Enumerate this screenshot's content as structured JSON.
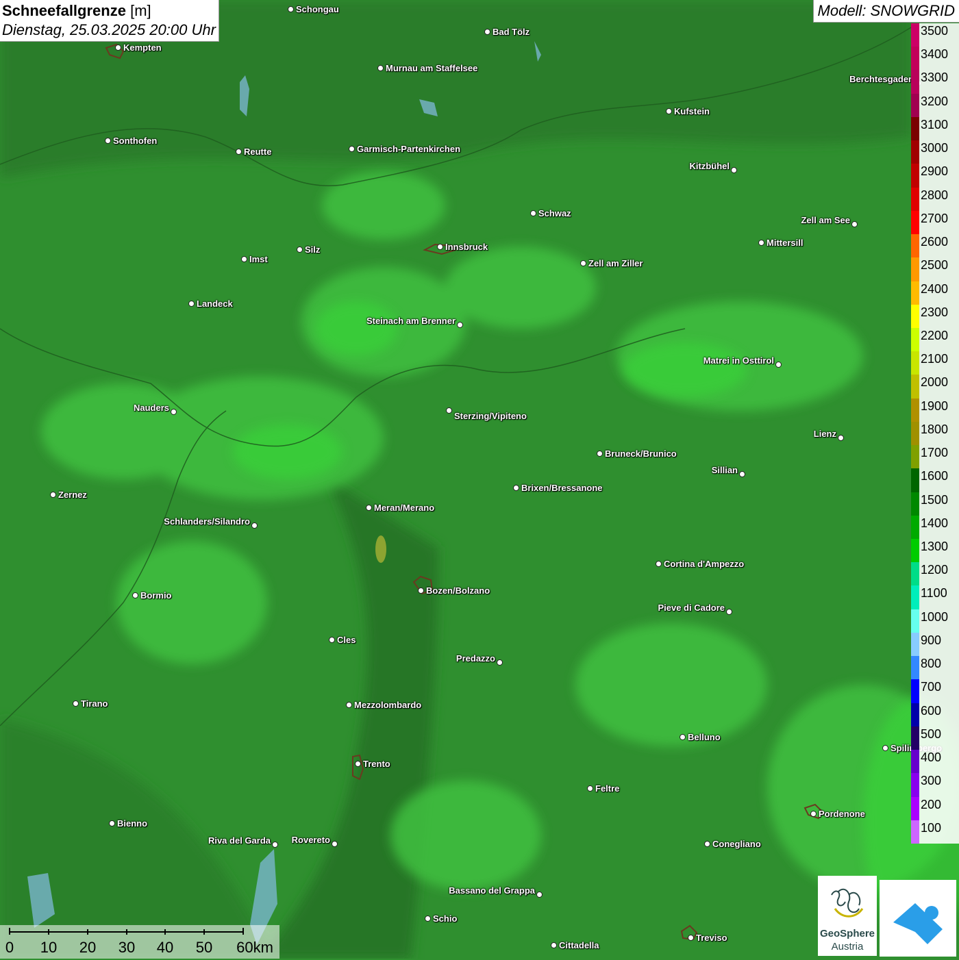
{
  "title": {
    "main": "Schneefallgrenze",
    "unit": "[m]",
    "datetime": "Dienstag, 25.03.2025 20:00 Uhr"
  },
  "model": "Modell: SNOWGRID",
  "legend": {
    "labels": [
      "3500",
      "3400",
      "3300",
      "3200",
      "3100",
      "3000",
      "2900",
      "2800",
      "2700",
      "2600",
      "2500",
      "2400",
      "2300",
      "2200",
      "2100",
      "2000",
      "1900",
      "1800",
      "1700",
      "1600",
      "1500",
      "1400",
      "1300",
      "1200",
      "1100",
      "1000",
      "900",
      "800",
      "700",
      "600",
      "500",
      "400",
      "300",
      "200",
      "100"
    ],
    "colors": [
      "#cc0066",
      "#c2005a",
      "#b8005a",
      "#a00050",
      "#7a0000",
      "#a00000",
      "#c00000",
      "#e00000",
      "#ff0000",
      "#ff6600",
      "#ff9900",
      "#ffbb00",
      "#ffff00",
      "#ccff00",
      "#c8e600",
      "#c0c000",
      "#b09000",
      "#a09000",
      "#80a000",
      "#006600",
      "#008800",
      "#00aa00",
      "#00cc00",
      "#00dd88",
      "#00eebb",
      "#66ffee",
      "#88ccff",
      "#3388ff",
      "#0000ff",
      "#0000aa",
      "#220066",
      "#6600cc",
      "#8800ee",
      "#aa00ff",
      "#cc66ff"
    ]
  },
  "cities": [
    {
      "name": "Schongau"
    },
    {
      "name": "Bad Tölz"
    },
    {
      "name": "Kempten"
    },
    {
      "name": "Murnau am Staffelsee"
    },
    {
      "name": "Berchtesgaden"
    },
    {
      "name": "Kufstein"
    },
    {
      "name": "Sonthofen"
    },
    {
      "name": "Reutte"
    },
    {
      "name": "Garmisch-Partenkirchen"
    },
    {
      "name": "Kitzbühel"
    },
    {
      "name": "Schwaz"
    },
    {
      "name": "Zell am See"
    },
    {
      "name": "Innsbruck"
    },
    {
      "name": "Mittersill"
    },
    {
      "name": "Imst"
    },
    {
      "name": "Silz"
    },
    {
      "name": "Zell am Ziller"
    },
    {
      "name": "Landeck"
    },
    {
      "name": "Steinach am Brenner"
    },
    {
      "name": "Matrei in Osttirol"
    },
    {
      "name": "Nauders"
    },
    {
      "name": "Sterzing/Vipiteno"
    },
    {
      "name": "Lienz"
    },
    {
      "name": "Bruneck/Brunico"
    },
    {
      "name": "Sillian"
    },
    {
      "name": "Brixen/Bressanone"
    },
    {
      "name": "Zernez"
    },
    {
      "name": "Meran/Merano"
    },
    {
      "name": "Schlanders/Silandro"
    },
    {
      "name": "Cortina d'Ampezzo"
    },
    {
      "name": "Bozen/Bolzano"
    },
    {
      "name": "Bormio"
    },
    {
      "name": "Pieve di Cadore"
    },
    {
      "name": "Cles"
    },
    {
      "name": "Predazzo"
    },
    {
      "name": "Tirano"
    },
    {
      "name": "Mezzolombardo"
    },
    {
      "name": "Belluno"
    },
    {
      "name": "Spilimbergo"
    },
    {
      "name": "Trento"
    },
    {
      "name": "Feltre"
    },
    {
      "name": "Pordenone"
    },
    {
      "name": "Bienno"
    },
    {
      "name": "Riva del Garda"
    },
    {
      "name": "Rovereto"
    },
    {
      "name": "Conegliano"
    },
    {
      "name": "Bassano del Grappa"
    },
    {
      "name": "Schio"
    },
    {
      "name": "Treviso"
    },
    {
      "name": "Cittadella"
    }
  ],
  "scale": {
    "ticks": [
      "0",
      "10",
      "20",
      "30",
      "40",
      "50",
      "60km"
    ]
  },
  "logos": {
    "geosphere_line1": "GeoSphere",
    "geosphere_line2": "Austria"
  },
  "colors": {
    "base_green": "#2f8f2f",
    "light_green": "#45c845",
    "bright_green": "#3ad83a",
    "dark_green": "#2a7a2a"
  }
}
